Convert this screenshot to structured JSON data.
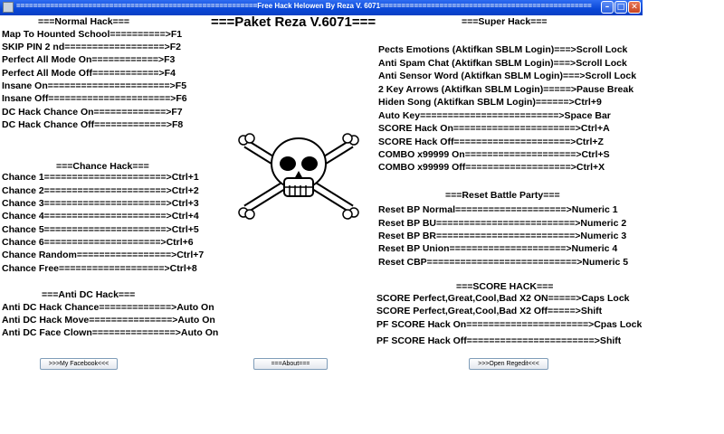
{
  "window": {
    "title": "=========================================================Free Hack Helowen By Reza V. 6071==============================================================="
  },
  "main_title": "===Paket Reza V.6071===",
  "normal": {
    "header": "===Normal Hack===",
    "items": [
      "Map To Hounted School==========>F1",
      "SKIP PIN 2 nd==================>F2",
      "Perfect All Mode On============>F3",
      "Perfect All Mode Off============>F4",
      "Insane On======================>F5",
      "Insane Off======================>F6",
      "DC Hack Chance On=============>F7",
      "DC Hack Chance Off=============>F8"
    ]
  },
  "chance": {
    "header": "===Chance Hack===",
    "items": [
      "Chance 1======================>Ctrl+1",
      "Chance 2======================>Ctrl+2",
      "Chance 3======================>Ctrl+3",
      "Chance 4======================>Ctrl+4",
      "Chance 5======================>Ctrl+5",
      "Chance  6=====================>Ctrl+6",
      "Chance Random=================>Ctrl+7",
      "Chance Free===================>Ctrl+8"
    ]
  },
  "antidc": {
    "header": "===Anti DC Hack===",
    "items": [
      "Anti DC Hack Chance=============>Auto On",
      "Anti DC Hack Move===============>Auto On",
      "Anti DC Face Clown===============>Auto On"
    ]
  },
  "super": {
    "header": "===Super Hack===",
    "items": [
      "Pects Emotions (Aktifkan SBLM Login)===>Scroll Lock",
      "Anti Spam Chat (Aktifkan SBLM Login)===>Scroll Lock",
      "Anti Sensor Word (Aktifkan SBLM Login)===>Scroll Lock",
      "2 Key Arrows (Aktifkan SBLM Login)=====>Pause Break",
      "Hiden Song (Aktifkan SBLM Login)======>Ctrl+9",
      "Auto Key=========================>Space Bar",
      "SCORE Hack On======================>Ctrl+A",
      "SCORE Hack Off=====================>Ctrl+Z",
      "COMBO x99999 On====================>Ctrl+S",
      "COMBO x99999 Off===================>Ctrl+X"
    ]
  },
  "resetbp": {
    "header": "===Reset Battle Party===",
    "items": [
      "Reset BP Normal====================>Numeric 1",
      "Reset BP BU=========================>Numeric 2",
      "Reset BP BR=========================>Numeric 3",
      "Reset BP Union=====================>Numeric 4",
      "Reset CBP===========================>Numeric 5"
    ]
  },
  "score": {
    "header": "===SCORE HACK===",
    "items": [
      "SCORE Perfect,Great,Cool,Bad X2 ON=====>Caps Lock",
      "SCORE Perfect,Great,Cool,Bad X2 Off=====>Shift",
      "PF SCORE Hack On======================>Cpas Lock",
      "PF SCORE Hack Off=======================>Shift"
    ]
  },
  "buttons": {
    "facebook": ">>>My Facebook<<<",
    "about": "===About===",
    "regedit": ">>>Open Regedit<<<"
  },
  "icons": {
    "window": "app-icon",
    "minimize": "minimize-icon",
    "maximize": "maximize-icon",
    "close": "close-icon",
    "skull": "skull-crossbones-icon"
  }
}
